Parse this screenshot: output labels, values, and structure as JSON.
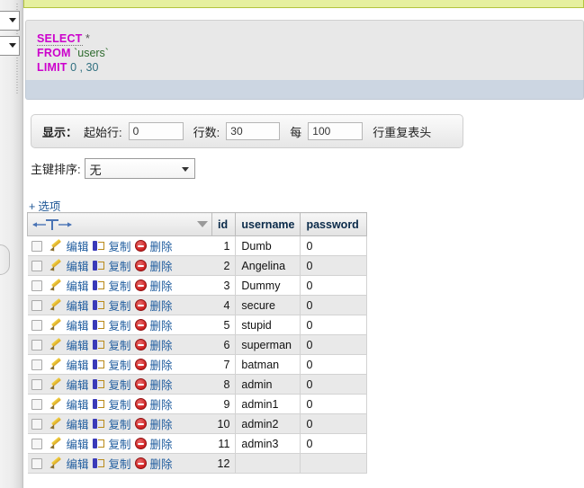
{
  "topbar": {
    "present": true,
    "color": "#e6f09f"
  },
  "sidebar": {
    "select1_icon": "chevron-down-icon",
    "select2_icon": "chevron-down-icon",
    "handle_label": ""
  },
  "sql": {
    "line1_kw": "SELECT",
    "line1_rest": " *",
    "line2_kw": "FROM",
    "line2_rest": " `users`",
    "line3_kw": "LIMIT",
    "line3_a": " 0",
    "line3_sep": " , ",
    "line3_b": "30"
  },
  "showbar": {
    "show_label": "显示：",
    "start_row_label": "起始行:",
    "start_row_value": "0",
    "row_count_label": "行数:",
    "row_count_value": "30",
    "every_label": "每",
    "every_value": "100",
    "repeat_header_label": "行重复表头"
  },
  "sort": {
    "label": "主键排序:",
    "value": "无",
    "arrow_icon": "chevron-down-icon"
  },
  "options": {
    "plus": "+",
    "label": "选项"
  },
  "table": {
    "actions_header_icon": "text-direction-icon",
    "sort_header_icon": "chevron-down-icon",
    "columns": [
      "id",
      "username",
      "password"
    ],
    "row_actions": {
      "edit": "编辑",
      "copy": "复制",
      "delete": "删除",
      "edit_icon": "pencil-icon",
      "copy_icon": "copy-icon",
      "delete_icon": "delete-circle-icon",
      "checkbox_icon": "checkbox-unchecked"
    },
    "rows": [
      {
        "id": "1",
        "username": "Dumb",
        "password": "0"
      },
      {
        "id": "2",
        "username": "Angelina",
        "password": "0"
      },
      {
        "id": "3",
        "username": "Dummy",
        "password": "0"
      },
      {
        "id": "4",
        "username": "secure",
        "password": "0"
      },
      {
        "id": "5",
        "username": "stupid",
        "password": "0"
      },
      {
        "id": "6",
        "username": "superman",
        "password": "0"
      },
      {
        "id": "7",
        "username": "batman",
        "password": "0"
      },
      {
        "id": "8",
        "username": "admin",
        "password": "0"
      },
      {
        "id": "9",
        "username": "admin1",
        "password": "0"
      },
      {
        "id": "10",
        "username": "admin2",
        "password": "0"
      },
      {
        "id": "11",
        "username": "admin3",
        "password": "0"
      },
      {
        "id": "12",
        "username": "",
        "password": ""
      }
    ]
  }
}
